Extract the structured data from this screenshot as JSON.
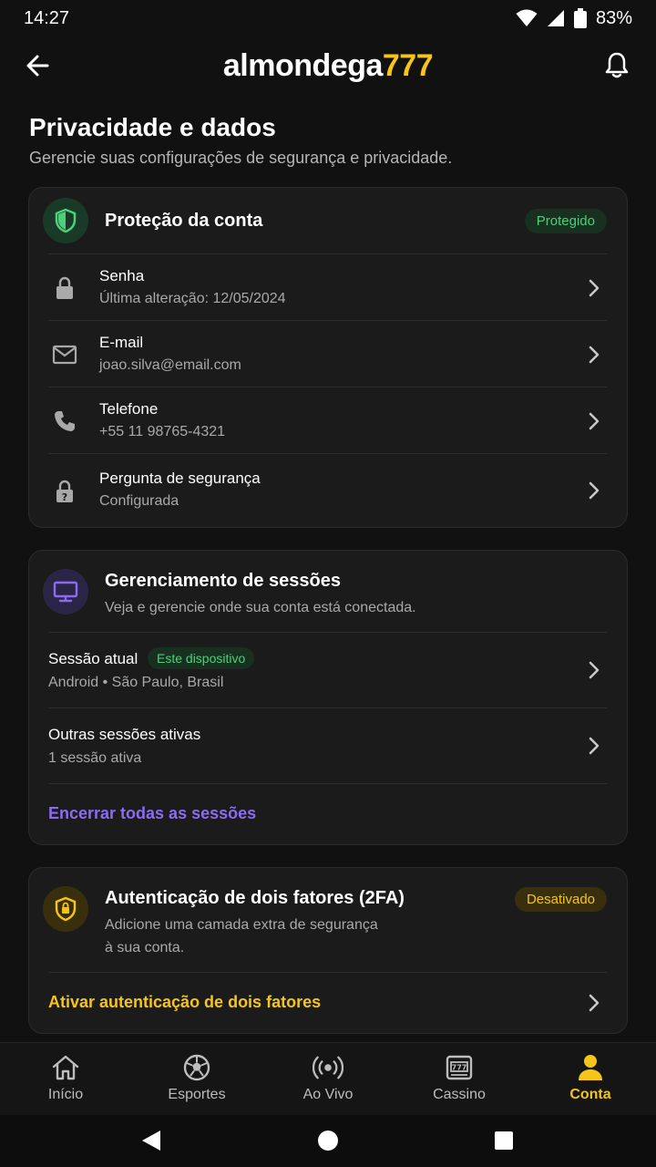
{
  "status_bar": {
    "time": "14:27",
    "battery": "83%"
  },
  "header": {
    "logo_text": "almondega",
    "logo_number": "777"
  },
  "page": {
    "title": "Privacidade e dados",
    "subtitle": "Gerencie suas configurações de segurança e privacidade."
  },
  "protection": {
    "title": "Proteção da conta",
    "badge": "Protegido",
    "items": [
      {
        "title": "Senha",
        "subtitle": "Última alteração: 12/05/2024",
        "icon": "lock-icon"
      },
      {
        "title": "E-mail",
        "subtitle": "joao.silva@email.com",
        "icon": "mail-icon"
      },
      {
        "title": "Telefone",
        "subtitle": "+55 11 98765-4321",
        "icon": "phone-icon"
      },
      {
        "title": "Pergunta de segurança",
        "subtitle": "Configurada",
        "icon": "lock-question-icon"
      }
    ]
  },
  "sessions": {
    "title": "Gerenciamento de sessões",
    "description": "Veja e gerencie onde sua conta está conectada.",
    "current": {
      "title": "Sessão atual",
      "badge": "Este dispositivo",
      "subtitle": "Android • São Paulo, Brasil"
    },
    "others": {
      "title": "Outras sessões ativas",
      "subtitle": "1 sessão ativa"
    },
    "end_all": "Encerrar todas as sessões"
  },
  "twofa": {
    "title": "Autenticação de dois fatores (2FA)",
    "badge": "Desativado",
    "description_line1": "Adicione uma camada extra de segurança",
    "description_line2": "à sua conta.",
    "action": "Ativar autenticação de dois fatores"
  },
  "bottom_nav": [
    {
      "label": "Início",
      "icon": "home-icon"
    },
    {
      "label": "Esportes",
      "icon": "soccer-ball-icon"
    },
    {
      "label": "Ao Vivo",
      "icon": "live-broadcast-icon"
    },
    {
      "label": "Cassino",
      "icon": "slot-machine-icon"
    },
    {
      "label": "Conta",
      "icon": "user-icon",
      "active": true
    }
  ],
  "colors": {
    "accent": "#f5c518",
    "success": "#4cd07a",
    "link": "#8b6cf0",
    "background": "#111111",
    "card": "#1b1b1b"
  }
}
